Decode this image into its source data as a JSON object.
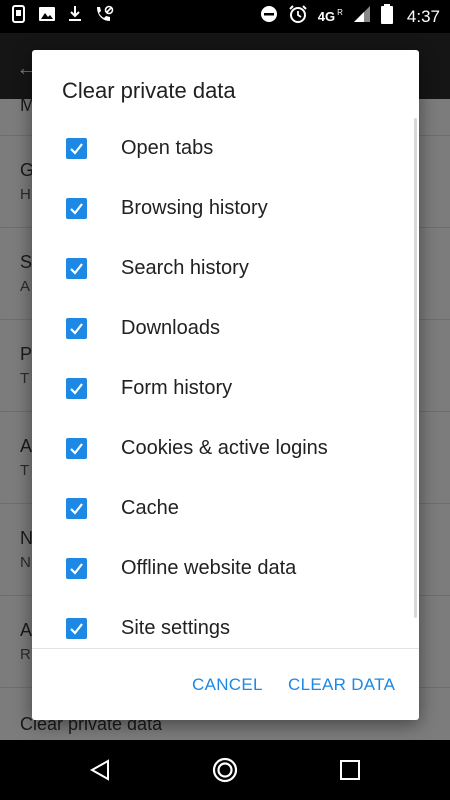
{
  "status_bar": {
    "time": "4:37",
    "network": "4G",
    "roaming": "R",
    "icons_left": [
      "screenshot-icon",
      "image-icon",
      "download-icon",
      "missed-call-icon"
    ],
    "icons_right": [
      "do-not-disturb-icon",
      "alarm-icon",
      "signal-icon",
      "battery-icon"
    ]
  },
  "background": {
    "rows": [
      {
        "title": "M",
        "subtitle": ""
      },
      {
        "title": "G",
        "subtitle": "H"
      },
      {
        "title": "S",
        "subtitle": "A"
      },
      {
        "title": "P",
        "subtitle": "T"
      },
      {
        "title": "A",
        "subtitle": "T"
      },
      {
        "title": "N",
        "subtitle": "N"
      },
      {
        "title": "A",
        "subtitle": "R"
      },
      {
        "title": "Clear private data",
        "subtitle": ""
      }
    ]
  },
  "dialog": {
    "title": "Clear private data",
    "options": [
      {
        "label": "Open tabs",
        "checked": true
      },
      {
        "label": "Browsing history",
        "checked": true
      },
      {
        "label": "Search history",
        "checked": true
      },
      {
        "label": "Downloads",
        "checked": true
      },
      {
        "label": "Form history",
        "checked": true
      },
      {
        "label": "Cookies & active logins",
        "checked": true
      },
      {
        "label": "Cache",
        "checked": true
      },
      {
        "label": "Offline website data",
        "checked": true
      },
      {
        "label": "Site settings",
        "checked": true
      }
    ],
    "cancel_label": "CANCEL",
    "confirm_label": "CLEAR DATA"
  },
  "colors": {
    "accent": "#1e88e5",
    "scrim": "#7c7c7c"
  },
  "nav": {
    "icons": [
      "back-icon",
      "home-icon",
      "recents-icon"
    ]
  }
}
